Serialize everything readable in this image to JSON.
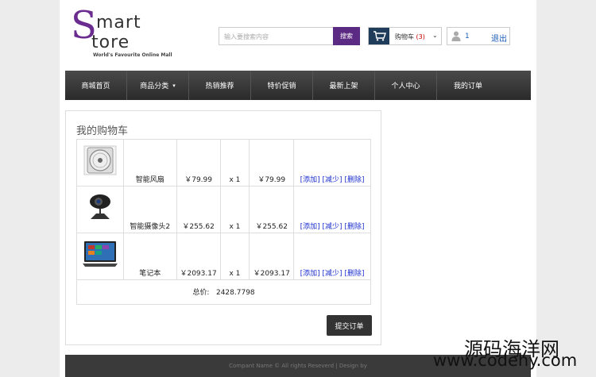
{
  "logo": {
    "s": "S",
    "word1": "mart",
    "word2": "tore",
    "tagline": "World's Favourite Online Mall"
  },
  "search": {
    "placeholder": "输入要搜索内容",
    "button": "搜索"
  },
  "cart": {
    "label": "购物车",
    "count": "(3)"
  },
  "user": {
    "id": "1",
    "logout": "退出"
  },
  "nav": {
    "items": [
      "商城首页",
      "商品分类",
      "热销推荐",
      "特价促销",
      "最新上架",
      "个人中心",
      "我的订单"
    ]
  },
  "panel": {
    "title": "我的购物车"
  },
  "items": [
    {
      "name": "智能风扇",
      "price": "￥79.99",
      "qty": "x 1",
      "subtotal": "￥79.99",
      "image": "fan-image"
    },
    {
      "name": "智能摄像头2",
      "price": "￥255.62",
      "qty": "x 1",
      "subtotal": "￥255.62",
      "image": "webcam-image"
    },
    {
      "name": "笔记本",
      "price": "￥2093.17",
      "qty": "x 1",
      "subtotal": "￥2093.17",
      "image": "laptop-image"
    }
  ],
  "ops": {
    "add": "[添加]",
    "reduce": "[减少]",
    "delete": "[删除]"
  },
  "total": {
    "label": "总价:",
    "value": "2428.7798"
  },
  "submit": "提交订单",
  "footer": "Compant Name © All rights Reseverd | Design by",
  "watermark": {
    "line1": "源码海洋网",
    "line2": "www.codehy.com"
  },
  "colors": {
    "brand": "#6a2c8e",
    "link": "#1c2fcf",
    "nav_bg": "#3a3a3a"
  }
}
